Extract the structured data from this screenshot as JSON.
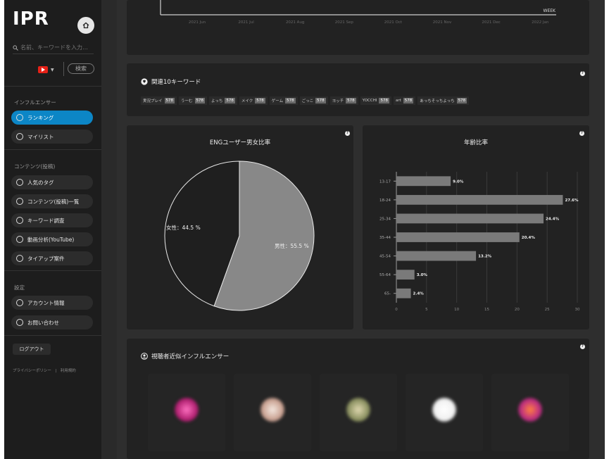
{
  "app": {
    "logo": "IPR"
  },
  "search": {
    "placeholder": "名前、キーワードを入力…",
    "button": "検索"
  },
  "sidebar": {
    "section_influencer": "インフルエンサー",
    "items_influencer": [
      {
        "label": "ランキング",
        "icon": "ranking-icon",
        "active": true
      },
      {
        "label": "マイリスト",
        "icon": "list-icon",
        "active": false
      }
    ],
    "section_content": "コンテンツ(投稿)",
    "items_content": [
      {
        "label": "人気のタグ",
        "icon": "tag-icon"
      },
      {
        "label": "コンテンツ(投稿)一覧",
        "icon": "content-icon"
      },
      {
        "label": "キーワード調査",
        "icon": "keyword-icon"
      },
      {
        "label": "動画分析(YouTube)",
        "icon": "video-icon"
      },
      {
        "label": "タイアップ案件",
        "icon": "tieup-icon"
      }
    ],
    "section_settings": "設定",
    "items_settings": [
      {
        "label": "アカウント情報",
        "icon": "account-icon"
      },
      {
        "label": "お問い合わせ",
        "icon": "mail-icon"
      }
    ],
    "logout": "ログアウト",
    "footer": "プライバシーポリシー　|　利用規約"
  },
  "timeline": {
    "week_label": "WEEK",
    "months": [
      "2021 Jun",
      "2021 Jul",
      "2021 Aug",
      "2021 Sep",
      "2021 Oct",
      "2021 Nov",
      "2021 Dec",
      "2022 Jan"
    ]
  },
  "keywords": {
    "title": "関連10キーワード",
    "items": [
      {
        "word": "実況プレイ",
        "count": "578"
      },
      {
        "word": "うーむ",
        "count": "578"
      },
      {
        "word": "よっち",
        "count": "578"
      },
      {
        "word": "メイク",
        "count": "578"
      },
      {
        "word": "ゲーム",
        "count": "578"
      },
      {
        "word": "ごっこ",
        "count": "578"
      },
      {
        "word": "ヨッチ",
        "count": "578"
      },
      {
        "word": "YOCCHI",
        "count": "578"
      },
      {
        "word": "art",
        "count": "578"
      },
      {
        "word": "あっちそっちよっち",
        "count": "578"
      }
    ]
  },
  "gender": {
    "title": "ENGユーザー男女比率",
    "female_label": "女性：44.5 %",
    "male_label": "男性：55.5 %"
  },
  "age": {
    "title": "年齢比率"
  },
  "similar": {
    "title": "視聴者近似インフルエンサー"
  },
  "chart_data": [
    {
      "type": "pie",
      "title": "ENGユーザー男女比率",
      "slices": [
        {
          "name": "男性",
          "value": 55.5,
          "color": "#888888"
        },
        {
          "name": "女性",
          "value": 44.5,
          "color": "#1f1f1f"
        }
      ]
    },
    {
      "type": "bar",
      "orientation": "horizontal",
      "title": "年齢比率",
      "categories": [
        "13-17",
        "18-24",
        "25-34",
        "35-44",
        "45-54",
        "55-64",
        "65-"
      ],
      "values": [
        9.0,
        27.6,
        24.4,
        20.4,
        13.2,
        3.0,
        2.4
      ],
      "value_labels": [
        "9.0%",
        "27.6%",
        "24.4%",
        "20.4%",
        "13.2%",
        "3.0%",
        "2.4%"
      ],
      "xlim": [
        0,
        30
      ],
      "xticks": [
        "0",
        "5",
        "10",
        "15",
        "20",
        "25",
        "30"
      ],
      "grid": true,
      "bar_color": "#7a7a7a"
    }
  ]
}
